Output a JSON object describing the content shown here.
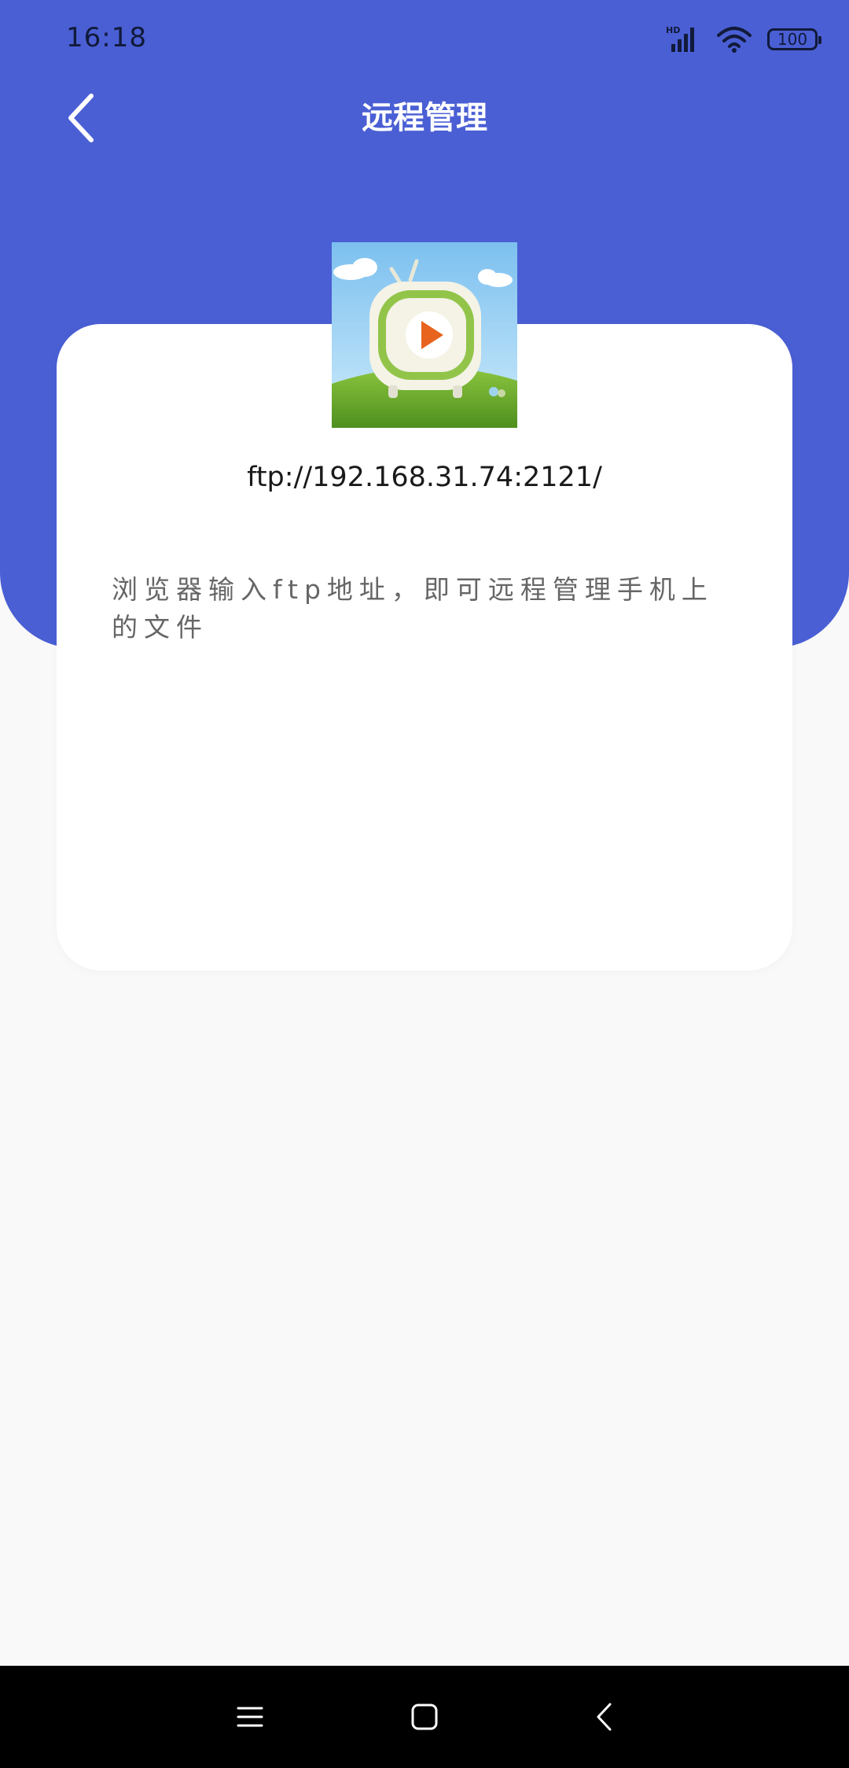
{
  "status_bar": {
    "time": "16:18",
    "network_label": "HD",
    "battery": "100",
    "icons": [
      "signal-icon",
      "wifi-icon",
      "battery-icon"
    ]
  },
  "header": {
    "title": "远程管理",
    "back_icon": "chevron-left-icon"
  },
  "card": {
    "app_icon": "tv-play-app-icon",
    "ftp_address": "ftp://192.168.31.74:2121/",
    "hint": "浏览器输入ftp地址，即可远程管理手机上的文件"
  },
  "nav_bar": {
    "icons": [
      "menu-icon",
      "home-icon",
      "back-icon"
    ]
  },
  "colors": {
    "primary": "#4a5fd4",
    "page_bg": "#f9f9f9",
    "card_bg": "#ffffff",
    "hint_text": "#666666"
  }
}
